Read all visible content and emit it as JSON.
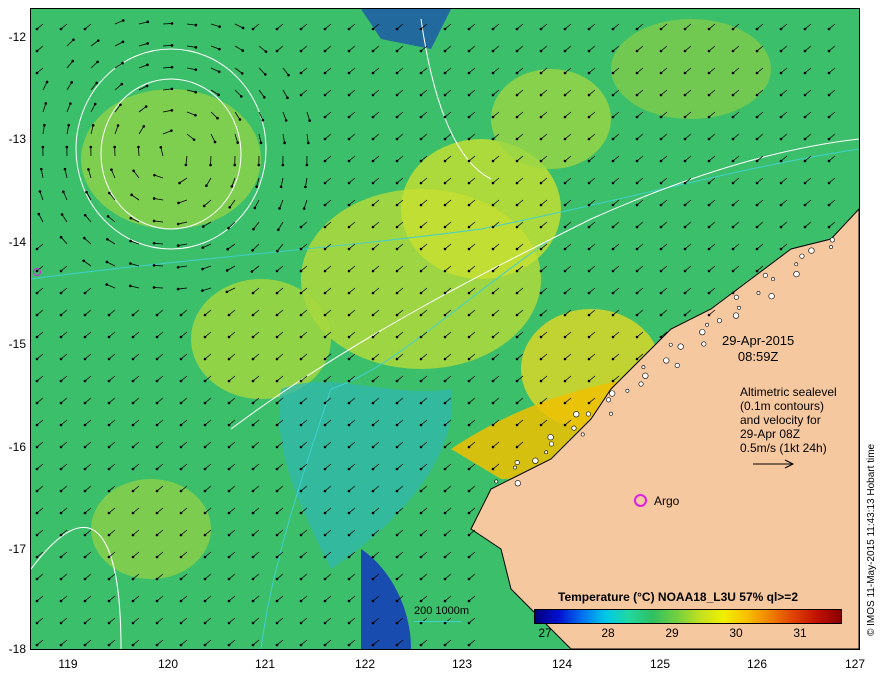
{
  "map": {
    "x_ticks": [
      "119",
      "120",
      "121",
      "122",
      "123",
      "124",
      "125",
      "126",
      "127"
    ],
    "y_ticks": [
      "-12",
      "-13",
      "-14",
      "-15",
      "-16",
      "-17",
      "-18"
    ],
    "date": "29-Apr-2015",
    "time": "08:59Z",
    "altimetry_lines": [
      "Altimetric sealevel",
      "(0.1m contours)",
      "and velocity for",
      "29-Apr 08Z",
      "0.5m/s (1kt 24h)"
    ],
    "argo_label": "Argo",
    "depth_legend": "200  1000m",
    "colorbar_title": "Temperature (°C) NOAA18_L3U 57% ql>=2",
    "colorbar_ticks": [
      "27",
      "28",
      "29",
      "30",
      "31"
    ],
    "credit": "© IMOS 11-May-2015 11:43:13 Hobart time",
    "colors": {
      "land": "#f6c8a0",
      "warm_coastal": "#f0c000",
      "cool_water": "#30b8b0",
      "argo_marker": "#e020e0",
      "isobath": "#40d0d0"
    }
  }
}
